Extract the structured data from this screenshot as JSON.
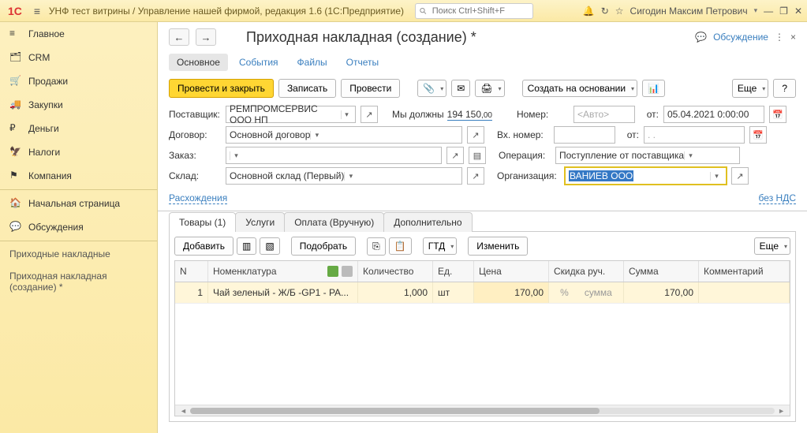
{
  "topbar": {
    "title": "УНФ тест витрины / Управление нашей фирмой, редакция 1.6  (1С:Предприятие)",
    "search_placeholder": "Поиск Ctrl+Shift+F",
    "user": "Сигодин Максим Петрович"
  },
  "sidebar": {
    "sections": [
      {
        "icon": "menu",
        "label": "Главное"
      },
      {
        "icon": "crm",
        "label": "CRM"
      },
      {
        "icon": "sales",
        "label": "Продажи"
      },
      {
        "icon": "purch",
        "label": "Закупки"
      },
      {
        "icon": "money",
        "label": "Деньги"
      },
      {
        "icon": "tax",
        "label": "Налоги"
      },
      {
        "icon": "company",
        "label": "Компания"
      }
    ],
    "favs": [
      {
        "icon": "home",
        "label": "Начальная страница"
      },
      {
        "icon": "chat",
        "label": "Обсуждения"
      }
    ],
    "history": [
      "Приходные накладные",
      "Приходная накладная (создание) *"
    ]
  },
  "doc": {
    "title": "Приходная накладная (создание) *",
    "discuss": "Обсуждение",
    "tabs": [
      "Основное",
      "События",
      "Файлы",
      "Отчеты"
    ]
  },
  "cmd": {
    "post_close": "Провести и закрыть",
    "write": "Записать",
    "post": "Провести",
    "create_from": "Создать на основании",
    "more": "Еще",
    "help": "?"
  },
  "form": {
    "supplier_lbl": "Поставщик:",
    "supplier_val": "РЕМПРОМСЕРВИС ООО НП",
    "debt_lbl": "Мы должны",
    "debt_int": "194 150",
    "debt_dec": ",00",
    "contract_lbl": "Договор:",
    "contract_val": "Основной договор",
    "order_lbl": "Заказ:",
    "order_val": "",
    "warehouse_lbl": "Склад:",
    "warehouse_val": "Основной склад (Первый)",
    "number_lbl": "Номер:",
    "number_ph": "<Авто>",
    "from_lbl": "от:",
    "date_val": "05.04.2021  0:00:00",
    "incnum_lbl": "Вх. номер:",
    "incnum_val": "",
    "incfrom_lbl": "от:",
    "incdate_val": ".  .",
    "op_lbl": "Операция:",
    "op_val": "Поступление от поставщика",
    "org_lbl": "Организация:",
    "org_val": "ВАНИЕВ ООО",
    "discrep": "Расхождения",
    "novat": "без НДС"
  },
  "tabs2": [
    "Товары (1)",
    "Услуги",
    "Оплата (Вручную)",
    "Дополнительно"
  ],
  "tablecmd": {
    "add": "Добавить",
    "pick": "Подобрать",
    "gtd": "ГТД",
    "change": "Изменить",
    "more": "Еще"
  },
  "grid": {
    "cols": [
      "N",
      "Номенклатура",
      "Количество",
      "Ед.",
      "Цена",
      "Скидка руч.",
      "Сумма",
      "Комментарий"
    ],
    "rows": [
      {
        "n": "1",
        "nom": "Чай зеленый - Ж/Б  -GP1 - PA...",
        "qty": "1,000",
        "ed": "шт",
        "price": "170,00",
        "disc": "%",
        "disc2": "сумма",
        "sum": "170,00",
        "comm": ""
      }
    ]
  }
}
